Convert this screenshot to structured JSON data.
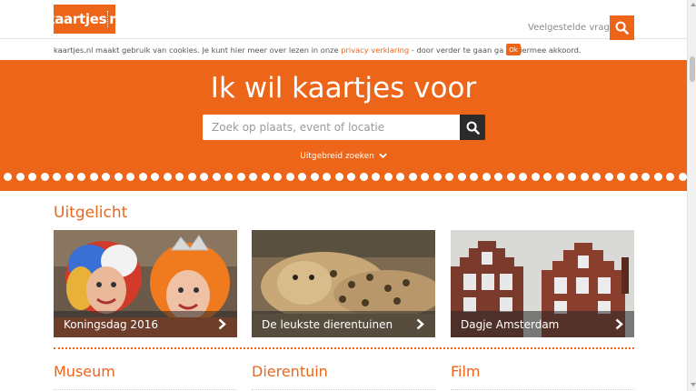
{
  "header": {
    "logo_left": "kaartjes",
    "logo_right": "nl",
    "faq_link": "Veelgestelde vragen"
  },
  "cookie": {
    "text_before": "kaartjes.nl maakt gebruik van cookies. Je kunt hier meer over lezen in onze ",
    "link": "privacy verklaring",
    "text_after": " - door verder te gaan ga je hiermee akkoord.",
    "ok_label": "Ok"
  },
  "hero": {
    "title": "Ik wil kaartjes voor",
    "search_placeholder": "Zoek op plaats, event of locatie",
    "advanced_label": "Uitgebreid zoeken"
  },
  "featured": {
    "title": "Uitgelicht",
    "cards": [
      {
        "label": "Koningsdag 2016"
      },
      {
        "label": "De leukste dierentuinen"
      },
      {
        "label": "Dagje Amsterdam"
      }
    ]
  },
  "categories": [
    "Museum",
    "Dierentuin",
    "Film"
  ],
  "colors": {
    "brand": "#ec6519",
    "dark": "#2b2b2b"
  },
  "icons": [
    "search-icon",
    "chevron-down-icon",
    "chevron-right-icon"
  ]
}
